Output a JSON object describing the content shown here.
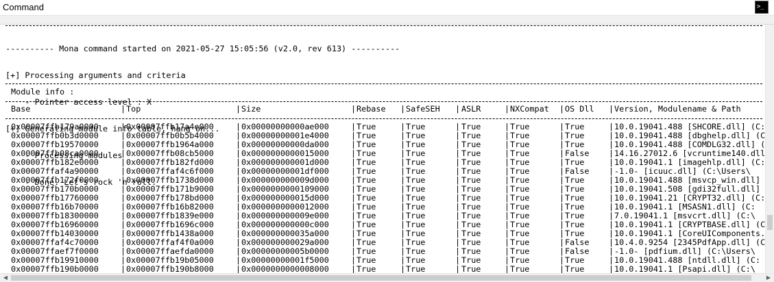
{
  "window": {
    "title": "Command",
    "icon": "command-prompt-icon",
    "icon_glyph": ">_"
  },
  "log": [
    "---------- Mona command started on 2021-05-27 15:05:56 (v2.0, rev 613) ----------",
    "[+] Processing arguments and criteria",
    "    - Pointer access level : X",
    "[+] Generating module info table, hang on...",
    "    - Processing modules",
    "    - Done. Let's rock 'n roll."
  ],
  "module_info_label": "Module info :",
  "table": {
    "headers": [
      "Base",
      "Top",
      "Size",
      "Rebase",
      "SafeSEH",
      "ASLR",
      "NXCompat",
      "OS Dll",
      "Version, Modulename & Path"
    ],
    "rows": [
      [
        "0x00007ffb179a0000",
        "0x00007ffb17a4e000",
        "0x00000000000ae000",
        "True",
        "True",
        "True",
        "True",
        "True",
        "10.0.19041.488 [SHCORE.dll] (C:"
      ],
      [
        "0x00007ffb0b3d0000",
        "0x00007ffb0b5b4000",
        "0x00000000001e4000",
        "True",
        "True",
        "True",
        "True",
        "True",
        "10.0.19041.488 [dbghelp.dll] (C"
      ],
      [
        "0x00007ffb19570000",
        "0x00007ffb1964a000",
        "0x00000000000da000",
        "True",
        "True",
        "True",
        "True",
        "True",
        "10.0.19041.488 [COMDLG32.dll] (C"
      ],
      [
        "0x00007ffb08ca0000",
        "0x00007ffb08cb5000",
        "0x0000000000015000",
        "True",
        "True",
        "True",
        "True",
        "False",
        "14.16.27012.6 [vcruntime140.dll]"
      ],
      [
        "0x00007ffb182e0000",
        "0x00007ffb182fd000",
        "0x000000000001d000",
        "True",
        "True",
        "True",
        "True",
        "True",
        "10.0.19041.1 [imagehlp.dll] (C:"
      ],
      [
        "0x00007ffaf4a90000",
        "0x00007ffaf4c6f000",
        "0x00000000001df000",
        "True",
        "True",
        "True",
        "True",
        "False",
        "-1.0- [icuuc.dll] (C:\\Users\\"
      ],
      [
        "0x00007ffb172f0000",
        "0x00007ffb1738d000",
        "0x000000000009d000",
        "True",
        "True",
        "True",
        "True",
        "True",
        "10.0.19041.488 [msvcp_win.dll] (C"
      ],
      [
        "0x00007ffb170b0000",
        "0x00007ffb171b9000",
        "0x0000000000109000",
        "True",
        "True",
        "True",
        "True",
        "True",
        "10.0.19041.508 [gdi32full.dll] (C"
      ],
      [
        "0x00007ffb17760000",
        "0x00007ffb178bd000",
        "0x000000000015d000",
        "True",
        "True",
        "True",
        "True",
        "True",
        "10.0.19041.21 [CRYPT32.dll] (C:"
      ],
      [
        "0x00007ffb16b70000",
        "0x00007ffb16b82000",
        "0x0000000000012000",
        "True",
        "True",
        "True",
        "True",
        "True",
        "10.0.19041.1 [MSASN1.dll] (C:"
      ],
      [
        "0x00007ffb18300000",
        "0x00007ffb1839e000",
        "0x000000000009e000",
        "True",
        "True",
        "True",
        "True",
        "True",
        "7.0.19041.1 [msvcrt.dll] (C:\\"
      ],
      [
        "0x00007ffb16960000",
        "0x00007ffb1696c000",
        "0x000000000000c000",
        "True",
        "True",
        "True",
        "True",
        "True",
        "10.0.19041.1 [CRYPTBASE.dll] (C"
      ],
      [
        "0x00007ffb14030000",
        "0x00007ffb1438a000",
        "0x000000000035a000",
        "True",
        "True",
        "True",
        "True",
        "True",
        "10.0.19041.1 [CoreUIComponents."
      ],
      [
        "0x00007ffaf4c70000",
        "0x00007ffaf4f0a000",
        "0x000000000029a000",
        "True",
        "True",
        "True",
        "True",
        "False",
        "10.4.0.9254 [2345PdfApp.dll] (C"
      ],
      [
        "0x00007ffaef7f0000",
        "0x00007ffaefda0000",
        "0x00000000005b0000",
        "True",
        "True",
        "True",
        "True",
        "False",
        "-1.0- [pdfium.dll] (C:\\Users\\"
      ],
      [
        "0x00007ffb19910000",
        "0x00007ffb19b05000",
        "0x00000000001f5000",
        "True",
        "True",
        "True",
        "True",
        "True",
        "10.0.19041.488 [ntdll.dll] (C:"
      ],
      [
        "0x00007ffb190b0000",
        "0x00007ffb190b8000",
        "0x0000000000008000",
        "True",
        "True",
        "True",
        "True",
        "True",
        "10.0.19041.1 [Psapi.dll] (C:\\"
      ]
    ]
  }
}
